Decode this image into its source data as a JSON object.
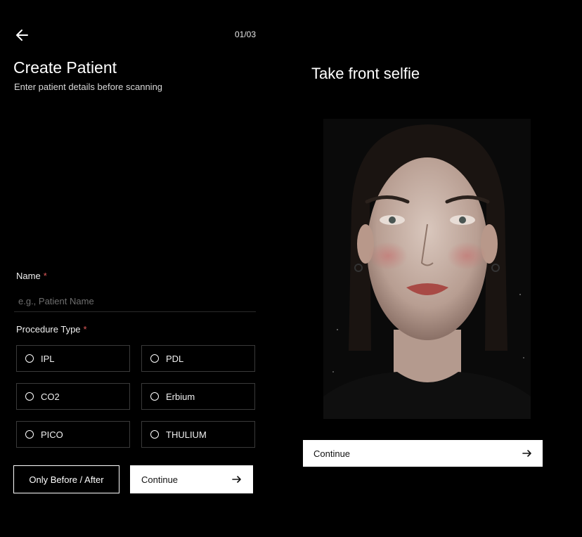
{
  "left_panel": {
    "step_counter": "01/03",
    "title": "Create Patient",
    "subtitle": "Enter patient details before scanning",
    "name_field": {
      "label": "Name",
      "required_mark": "*",
      "placeholder": "e.g., Patient Name",
      "value": ""
    },
    "procedure": {
      "label": "Procedure Type",
      "required_mark": "*",
      "options": [
        "IPL",
        "PDL",
        "CO2",
        "Erbium",
        "PICO",
        "THULIUM"
      ],
      "selected": ""
    },
    "only_before_after_label": "Only Before / After",
    "continue_label": "Continue"
  },
  "right_panel": {
    "title": "Take front selfie",
    "continue_label": "Continue"
  },
  "icons": {
    "back": "arrow-left-icon",
    "continue": "arrow-right-icon",
    "radio": "radio-unchecked-icon"
  },
  "colors": {
    "background": "#000000",
    "text": "#ffffff",
    "required": "#e05a5a",
    "button_fill": "#ffffff",
    "option_border": "#3a3a3a"
  }
}
